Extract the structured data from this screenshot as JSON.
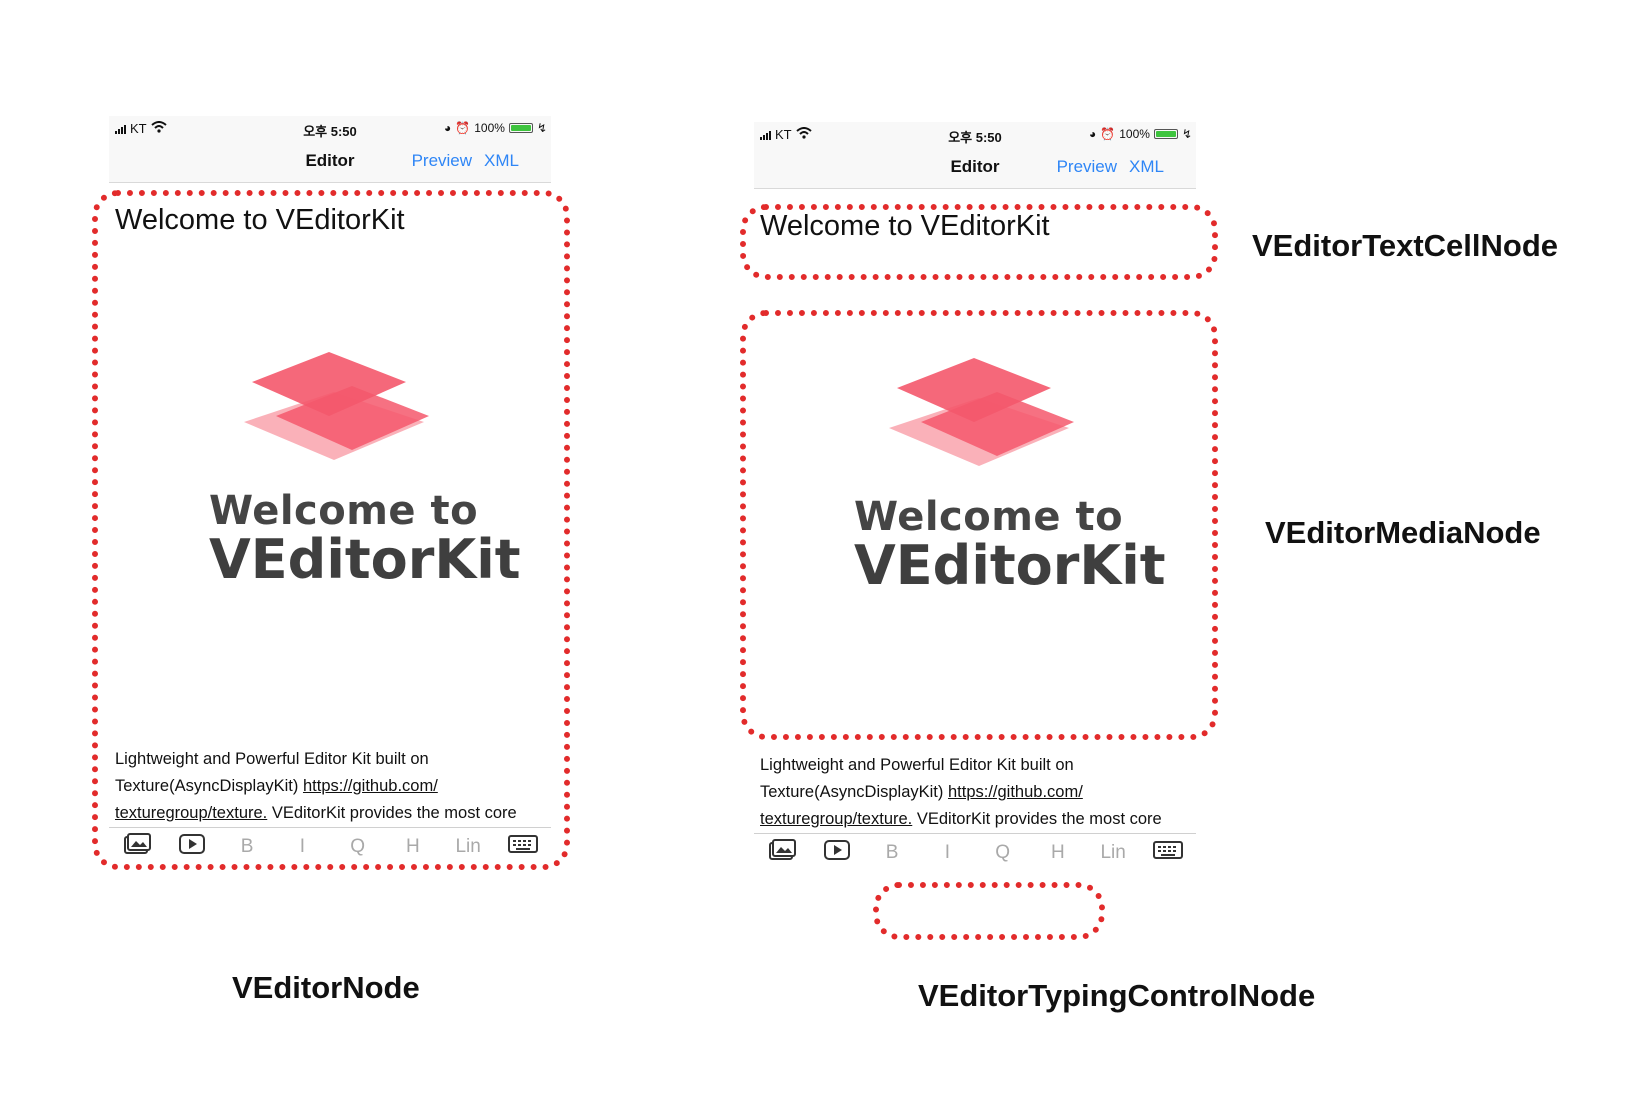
{
  "colors": {
    "annotation": "#e22b2b",
    "link": "#2f86f6",
    "logo_primary": "#f4586c",
    "logo_light": "#f9a3ad"
  },
  "phone": {
    "status": {
      "carrier": "KT",
      "time": "오후 5:50",
      "battery": "100%",
      "battery_level": 1.0
    },
    "nav": {
      "title": "Editor",
      "preview": "Preview",
      "xml": "XML"
    },
    "title_text": "Welcome to VEditorKit",
    "media": {
      "line1": "Welcome to",
      "line2": "VEditorKit"
    },
    "body": {
      "line1": "Lightweight and Powerful Editor Kit built on",
      "line2_prefix": "Texture(AsyncDisplayKit) ",
      "link1": "https://github.com/",
      "link2": "texturegroup/texture.",
      "line3_suffix": " VEditorKit provides the most core"
    },
    "toolbar": {
      "bold": "B",
      "italic": "I",
      "quote": "Q",
      "heading": "H",
      "link": "Lin"
    }
  },
  "captions": {
    "editor_node": "VEditorNode",
    "typing_control_node": "VEditorTypingControlNode",
    "text_cell_node": "VEditorTextCellNode",
    "media_node": "VEditorMediaNode"
  }
}
